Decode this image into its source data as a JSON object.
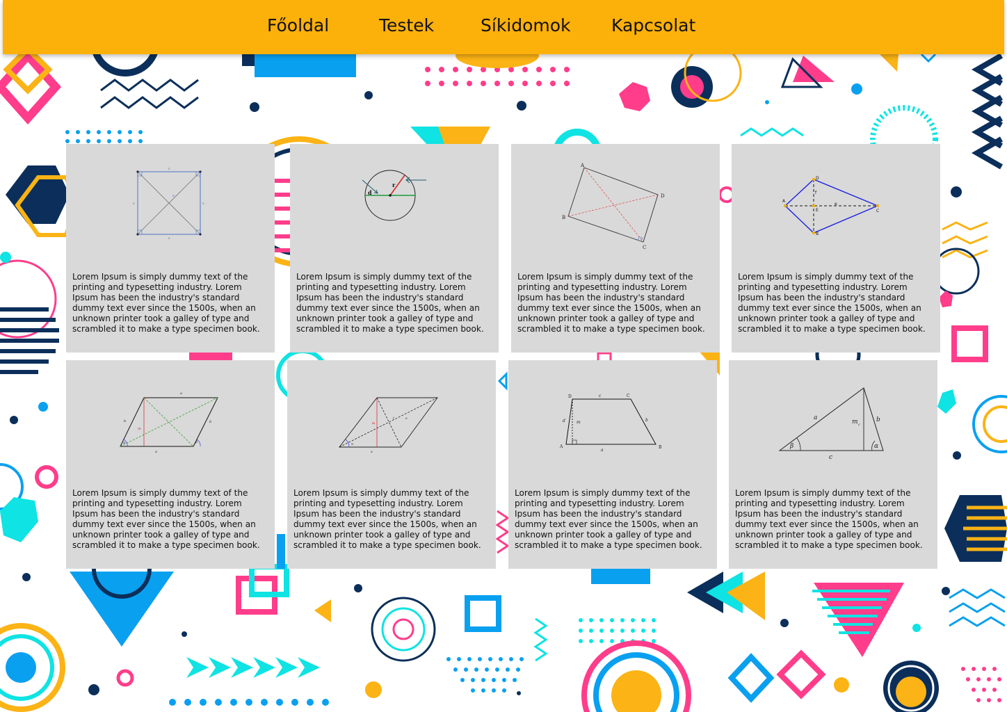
{
  "nav": {
    "items": [
      {
        "label": "Főoldal"
      },
      {
        "label": "Testek"
      },
      {
        "label": "Síkidomok"
      },
      {
        "label": "Kapcsolat"
      }
    ]
  },
  "cards": [
    {
      "figure": "square-diagram",
      "text": "Lorem Ipsum is simply dummy text of the printing and typesetting industry. Lorem Ipsum has been the industry's standard dummy text ever since the 1500s, when an unknown printer took a galley of type and scrambled it to make a type specimen book."
    },
    {
      "figure": "circle-diagram",
      "text": "Lorem Ipsum is simply dummy text of the printing and typesetting industry. Lorem Ipsum has been the industry's standard dummy text ever since the 1500s, when an unknown printer took a galley of type and scrambled it to make a type specimen book."
    },
    {
      "figure": "rectangle-diagram",
      "text": "Lorem Ipsum is simply dummy text of the printing and typesetting industry. Lorem Ipsum has been the industry's standard dummy text ever since the 1500s, when an unknown printer took a galley of type and scrambled it to make a type specimen book."
    },
    {
      "figure": "kite-diagram",
      "text": "Lorem Ipsum is simply dummy text of the printing and typesetting industry. Lorem Ipsum has been the industry's standard dummy text ever since the 1500s, when an unknown printer took a galley of type and scrambled it to make a type specimen book."
    },
    {
      "figure": "parallelogram-diagram",
      "text": "Lorem Ipsum is simply dummy text of the printing and typesetting industry. Lorem Ipsum has been the industry's standard dummy text ever since the 1500s, when an unknown printer took a galley of type and scrambled it to make a type specimen book."
    },
    {
      "figure": "rhombus-diagram",
      "text": "Lorem Ipsum is simply dummy text of the printing and typesetting industry. Lorem Ipsum has been the industry's standard dummy text ever since the 1500s, when an unknown printer took a galley of type and scrambled it to make a type specimen book."
    },
    {
      "figure": "trapezoid-diagram",
      "text": "Lorem Ipsum is simply dummy text of the printing and typesetting industry. Lorem Ipsum has been the industry's standard dummy text ever since the 1500s, when an unknown printer took a galley of type and scrambled it to make a type specimen book."
    },
    {
      "figure": "triangle-diagram",
      "text": "Lorem Ipsum is simply dummy text of the printing and typesetting industry. Lorem Ipsum has been the industry's standard dummy text ever since the 1500s, when an unknown printer took a galley of type and scrambled it to make a type specimen book."
    }
  ],
  "figure_labels": {
    "square": [
      "a",
      "a",
      "a",
      "a",
      "d"
    ],
    "circle": [
      "d",
      "r"
    ],
    "rectangle": [
      "A",
      "B",
      "C",
      "D"
    ],
    "kite": [
      "A",
      "B",
      "C",
      "D",
      "e",
      "f",
      "E"
    ],
    "parallelogram": [
      "a",
      "b",
      "a",
      "b",
      "m",
      "α",
      "β"
    ],
    "rhombus": [
      "a",
      "e",
      "f",
      "m",
      "α"
    ],
    "trapezoid": [
      "A",
      "B",
      "C",
      "D",
      "a",
      "b",
      "c",
      "d",
      "m"
    ],
    "triangle": [
      "a",
      "b",
      "c",
      "m",
      "c",
      "β",
      "α"
    ]
  },
  "colors": {
    "nav_bg": "#fcb00a",
    "card_bg": "#d9d9d9",
    "navy": "#0b2f5a",
    "pink": "#ff3d8b",
    "cyan": "#0fe3e3",
    "blue": "#0aa0f0",
    "yellow": "#fbb315"
  }
}
